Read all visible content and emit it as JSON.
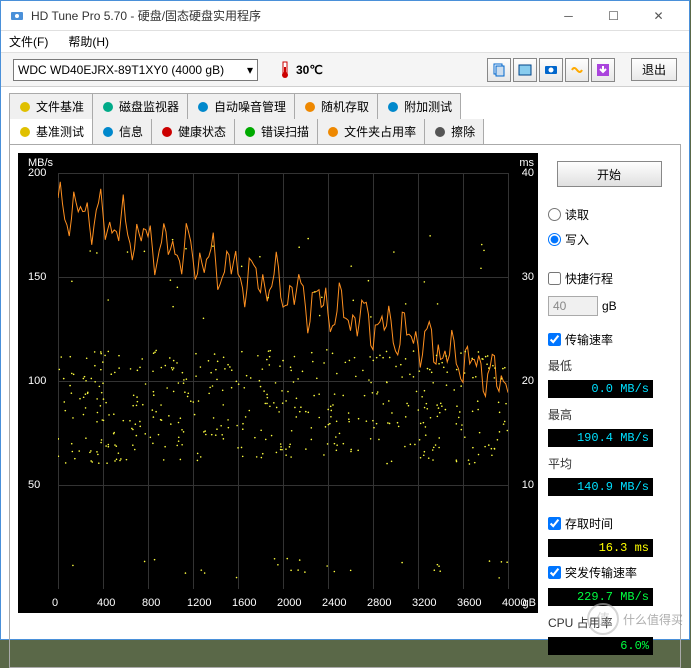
{
  "window": {
    "title": "HD Tune Pro 5.70 - 硬盘/固态硬盘实用程序"
  },
  "menu": {
    "file": "文件(F)",
    "help": "帮助(H)"
  },
  "toolbar": {
    "drive": "WDC WD40EJRX-89T1XY0 (4000 gB)",
    "temp": "30℃",
    "exit": "退出"
  },
  "tabs_row1": [
    {
      "label": "文件基准"
    },
    {
      "label": "磁盘监视器"
    },
    {
      "label": "自动噪音管理"
    },
    {
      "label": "随机存取"
    },
    {
      "label": "附加测试"
    }
  ],
  "tabs_row2": [
    {
      "label": "基准测试",
      "active": true
    },
    {
      "label": "信息"
    },
    {
      "label": "健康状态"
    },
    {
      "label": "错误扫描"
    },
    {
      "label": "文件夹占用率"
    },
    {
      "label": "擦除"
    }
  ],
  "panel": {
    "start": "开始",
    "read": "读取",
    "write": "写入",
    "short_stroke": "快捷行程",
    "stroke_val": "40",
    "stroke_unit": "gB",
    "transfer_rate": "传输速率",
    "min_label": "最低",
    "min_val": "0.0 MB/s",
    "max_label": "最高",
    "max_val": "190.4 MB/s",
    "avg_label": "平均",
    "avg_val": "140.9 MB/s",
    "access_time": "存取时间",
    "access_val": "16.3 ms",
    "burst": "突发传输速率",
    "burst_val": "229.7 MB/s",
    "cpu": "CPU 占用率",
    "cpu_val": "6.0%"
  },
  "chart": {
    "yleft_unit": "MB/s",
    "yright_unit": "ms",
    "x_unit": "gB",
    "yleft_ticks": [
      "200",
      "150",
      "100",
      "50"
    ],
    "yright_ticks": [
      "40",
      "30",
      "20",
      "10"
    ],
    "x_ticks": [
      "0",
      "400",
      "800",
      "1200",
      "1600",
      "2000",
      "2400",
      "2800",
      "3200",
      "3600",
      "4000"
    ]
  },
  "chart_data": {
    "type": "line",
    "title": "",
    "xlabel": "gB",
    "ylabel_left": "MB/s",
    "ylabel_right": "ms",
    "xlim": [
      0,
      4000
    ],
    "ylim_left": [
      0,
      200
    ],
    "ylim_right": [
      0,
      40
    ],
    "series": [
      {
        "name": "Transfer Rate (MB/s)",
        "axis": "left",
        "color": "#ff9020",
        "x": [
          0,
          200,
          400,
          600,
          800,
          1000,
          1200,
          1400,
          1600,
          1800,
          2000,
          2200,
          2400,
          2600,
          2800,
          3000,
          3200,
          3400,
          3600,
          3800,
          4000
        ],
        "values": [
          182,
          180,
          175,
          170,
          165,
          163,
          158,
          155,
          150,
          147,
          142,
          138,
          133,
          130,
          126,
          122,
          118,
          112,
          108,
          102,
          95
        ]
      },
      {
        "name": "Access Time (ms)",
        "axis": "right",
        "color": "#ffff40",
        "type": "scatter",
        "mean": 16.3,
        "range": [
          4,
          30
        ],
        "note": "random scatter concentrated 12-22ms with outliers near 1ms and 30ms"
      }
    ]
  },
  "watermark": "什么值得买"
}
